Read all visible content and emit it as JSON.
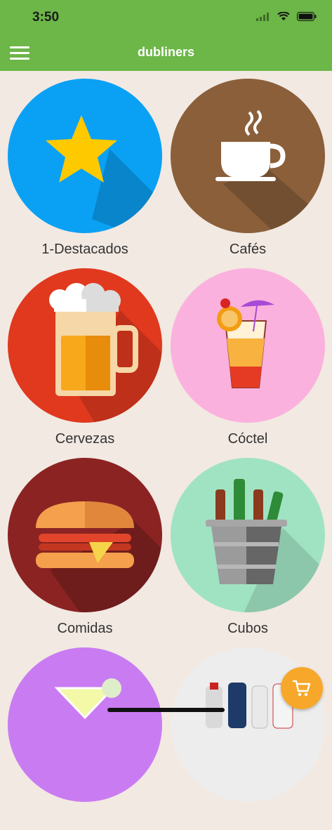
{
  "status": {
    "time": "3:50"
  },
  "header": {
    "title": "dubliners"
  },
  "categories": [
    {
      "label": "1-Destacados",
      "icon": "star-icon",
      "color": "#0aa1f4"
    },
    {
      "label": "Cafés",
      "icon": "coffee-cup-icon",
      "color": "#8a5f3a"
    },
    {
      "label": "Cervezas",
      "icon": "beer-mug-icon",
      "color": "#e0391e"
    },
    {
      "label": "Cóctel",
      "icon": "cocktail-icon",
      "color": "#fbb1dd"
    },
    {
      "label": "Comidas",
      "icon": "burger-icon",
      "color": "#8b2323"
    },
    {
      "label": "Cubos",
      "icon": "beer-bucket-icon",
      "color": "#a0e3c3"
    },
    {
      "label": "",
      "icon": "martini-icon",
      "color": "#c97cf2"
    },
    {
      "label": "",
      "icon": "liquor-bottles-icon",
      "color": "#ededed"
    }
  ],
  "cart": {
    "icon": "cart-icon",
    "color": "#f7a82a"
  },
  "brand": {
    "green": "#6db648",
    "background": "#f2e9e2"
  }
}
